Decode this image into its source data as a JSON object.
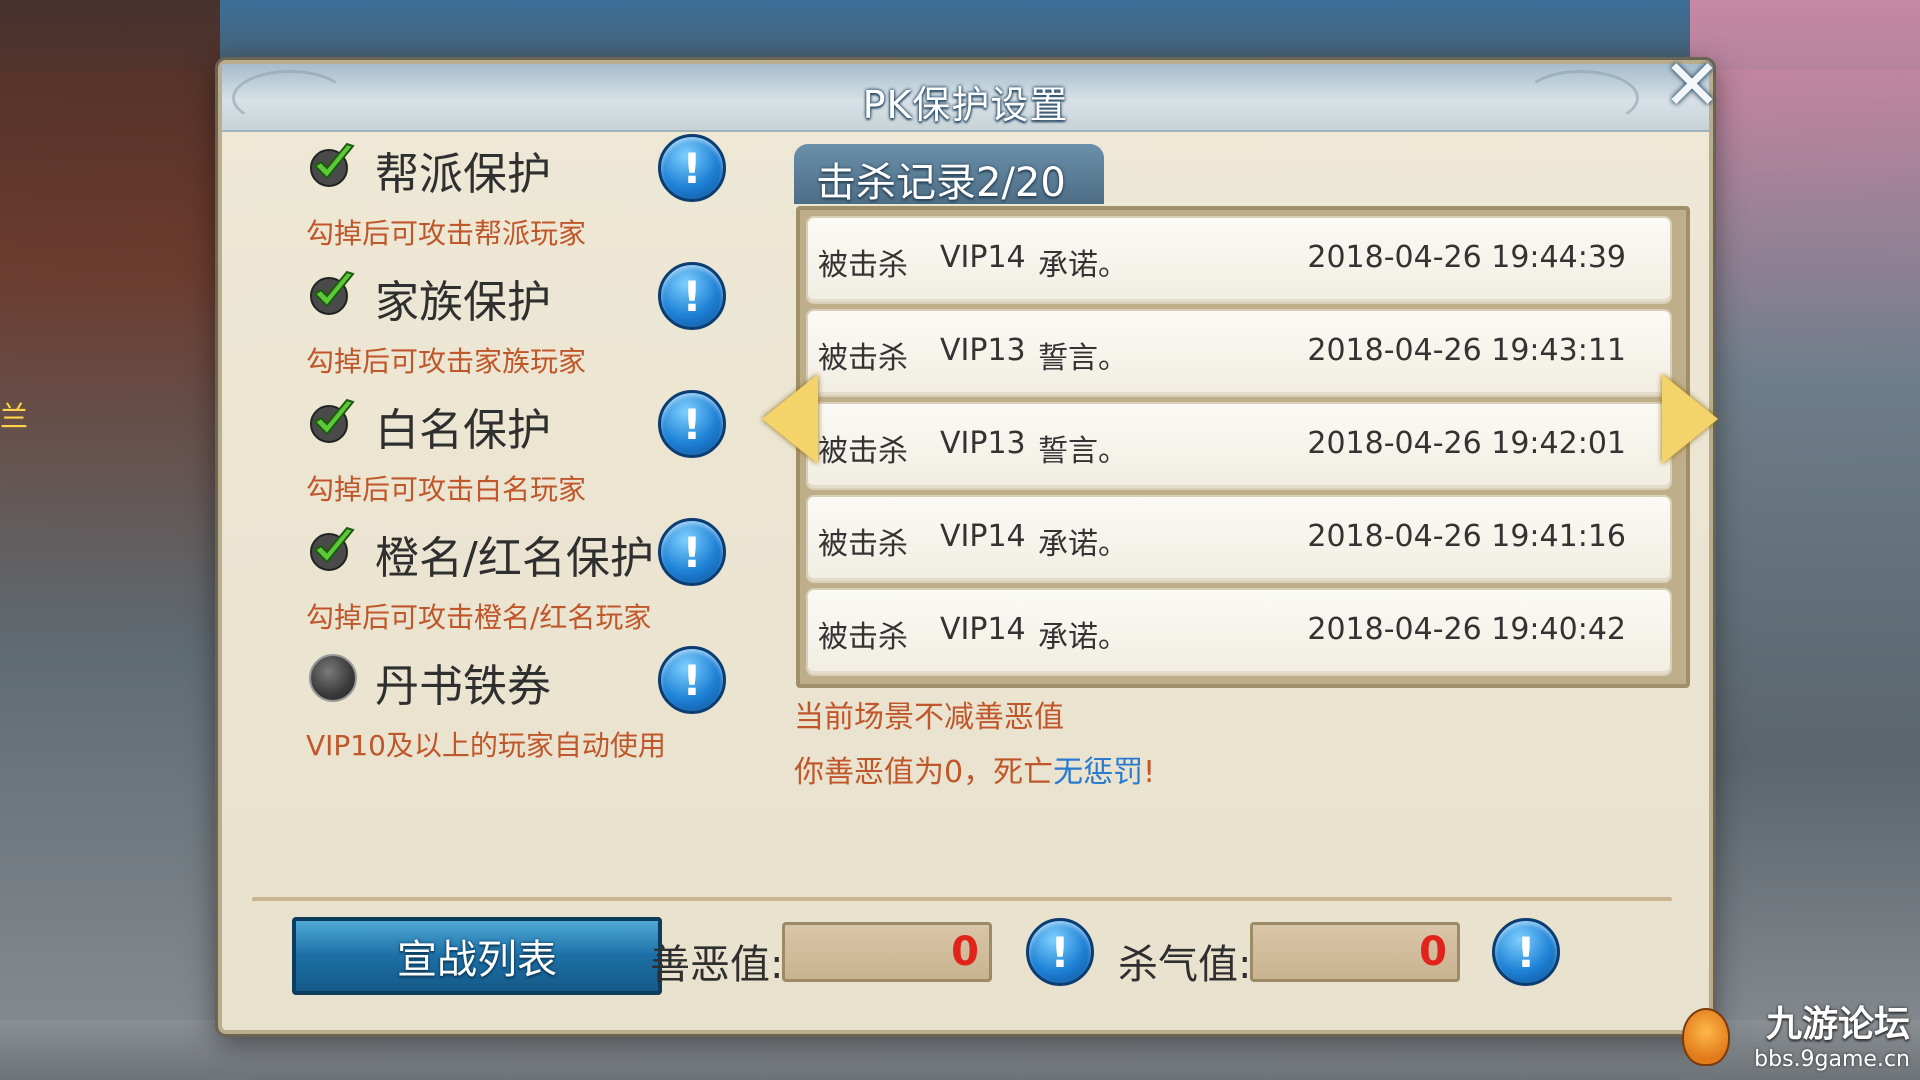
{
  "background": {
    "label": "兰"
  },
  "dialog": {
    "title": "PK保护设置",
    "close_label": "✕"
  },
  "protections": [
    {
      "label": "帮派保护",
      "desc": "勾掉后可攻击帮派玩家",
      "checked": true
    },
    {
      "label": "家族保护",
      "desc": "勾掉后可攻击家族玩家",
      "checked": true
    },
    {
      "label": "白名保护",
      "desc": "勾掉后可攻击白名玩家",
      "checked": true
    },
    {
      "label": "橙名/红名保护",
      "desc": "勾掉后可攻击橙名/红名玩家",
      "checked": true
    },
    {
      "label": "丹书铁券",
      "desc": "VIP10及以上的玩家自动使用",
      "checked": false
    }
  ],
  "kill_record": {
    "tab_label": "击杀记录2/20",
    "rows": [
      {
        "type": "被击杀",
        "vip": "VIP14",
        "name": "承诺。",
        "time": "2018-04-26 19:44:39"
      },
      {
        "type": "被击杀",
        "vip": "VIP13",
        "name": "誓言。",
        "time": "2018-04-26 19:43:11"
      },
      {
        "type": "被击杀",
        "vip": "VIP13",
        "name": "誓言。",
        "time": "2018-04-26 19:42:01"
      },
      {
        "type": "被击杀",
        "vip": "VIP14",
        "name": "承诺。",
        "time": "2018-04-26 19:41:16"
      },
      {
        "type": "被击杀",
        "vip": "VIP14",
        "name": "承诺。",
        "time": "2018-04-26 19:40:42"
      }
    ]
  },
  "notes": {
    "line1": "当前场景不减善恶值",
    "line2_prefix": "你善恶值为0，死亡",
    "line2_highlight": "无惩罚",
    "line2_suffix": "!"
  },
  "footer": {
    "war_list_label": "宣战列表",
    "good_evil_label": "善恶值:",
    "good_evil_value": "0",
    "kill_aura_label": "杀气值:",
    "kill_aura_value": "0",
    "info_glyph": "!"
  },
  "watermark": {
    "title": "九游论坛",
    "url": "bbs.9game.cn"
  },
  "colors": {
    "desc_text": "#c0572a",
    "highlight": "#2a7ad0",
    "stat_value": "#e0241c"
  }
}
